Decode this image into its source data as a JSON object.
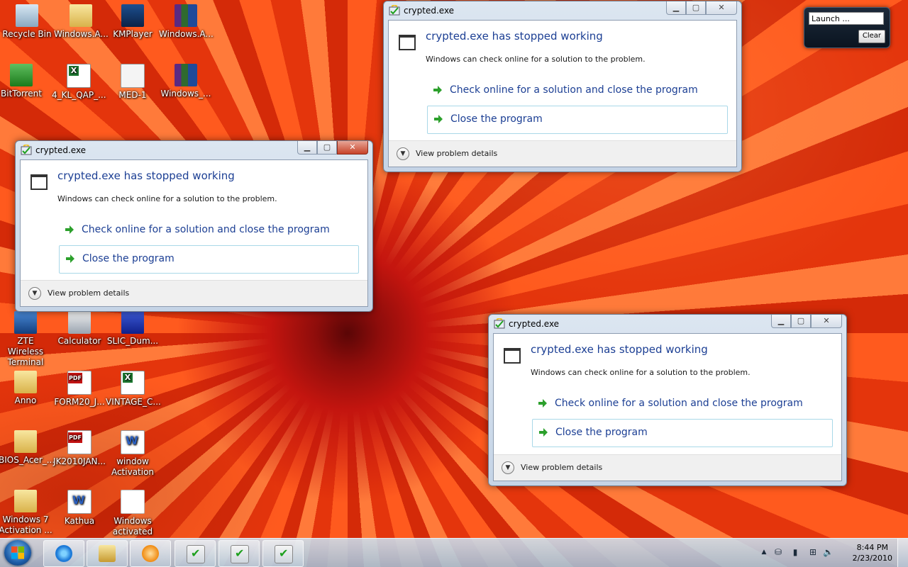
{
  "desktop_icons": [
    {
      "label": "Recycle Bin",
      "icon": "recycle-bin-icon"
    },
    {
      "label": "Windows.A...",
      "icon": "folder-icon"
    },
    {
      "label": "KMPlayer",
      "icon": "kmplayer-icon"
    },
    {
      "label": "Windows.A...",
      "icon": "winrar-icon"
    },
    {
      "label": "BitTorrent",
      "icon": "bittorrent-icon"
    },
    {
      "label": "4_KL_QAP_...",
      "icon": "excel-icon"
    },
    {
      "label": "MED-1",
      "icon": "document-icon"
    },
    {
      "label": "Windows_...",
      "icon": "winrar-icon"
    },
    {
      "label": "ZTE Wireless Terminal",
      "icon": "zte-icon"
    },
    {
      "label": "Calculator",
      "icon": "calculator-icon"
    },
    {
      "label": "SLIC_Dum...",
      "icon": "slic-icon"
    },
    {
      "label": "Anno",
      "icon": "folder-icon"
    },
    {
      "label": "FORM20_J...",
      "icon": "pdf-icon"
    },
    {
      "label": "VINTAGE_C...",
      "icon": "excel-icon"
    },
    {
      "label": "BIOS_Acer_...",
      "icon": "folder-icon"
    },
    {
      "label": "JK2010JAN...",
      "icon": "pdf-icon"
    },
    {
      "label": "window Activation",
      "icon": "word-icon"
    },
    {
      "label": "Windows 7 Activation ...",
      "icon": "folder-icon"
    },
    {
      "label": "Kathua",
      "icon": "word-icon"
    },
    {
      "label": "Windows activated",
      "icon": "envelope-icon"
    }
  ],
  "dialog": {
    "window_title": "crypted.exe",
    "heading": "crypted.exe has stopped working",
    "subtext": "Windows can check online for a solution to the problem.",
    "option_check": "Check online for a solution and close the program",
    "option_close": "Close the program",
    "details": "View problem details",
    "minimize_glyph": "▁",
    "maximize_glyph": "▢",
    "close_glyph": "✕"
  },
  "gadget": {
    "field_text": "Launch ...",
    "clear_label": "Clear"
  },
  "taskbar": {
    "time": "8:44 PM",
    "date": "2/23/2010",
    "tray_glyphs": {
      "expand": "▲",
      "network": "⛁",
      "battery": "▮",
      "volume": "🔈"
    }
  }
}
